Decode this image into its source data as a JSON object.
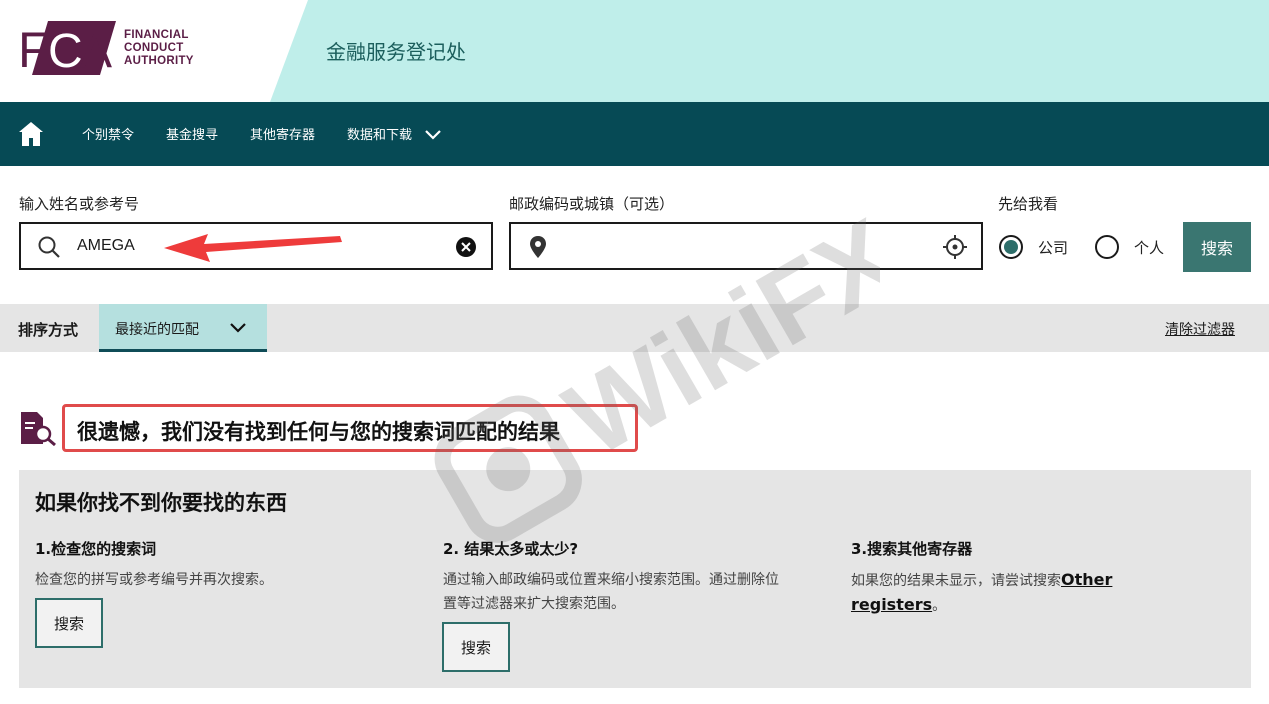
{
  "brand": {
    "logo_letters": "FCA",
    "logo_words": [
      "FINANCIAL",
      "CONDUCT",
      "AUTHORITY"
    ],
    "site_title": "金融服务登记处",
    "brand_color": "#5b1e46",
    "header_accent": "#bfeeea",
    "nav_color": "#064a55"
  },
  "nav": {
    "home_icon": "home-icon",
    "items": [
      "个别禁令",
      "基金搜寻",
      "其他寄存器",
      "数据和下载"
    ]
  },
  "search": {
    "name_label": "输入姓名或参考号",
    "name_value": "AMEGA",
    "location_label": "邮政编码或城镇（可选）",
    "location_value": "",
    "show_first_label": "先给我看",
    "options": [
      "公司",
      "个人"
    ],
    "selected_option": "公司",
    "button_label": "搜索"
  },
  "sort": {
    "label": "排序方式",
    "value": "最接近的匹配",
    "clear_label": "清除过滤器"
  },
  "no_results": {
    "message": "很遗憾，我们没有找到任何与您的搜索词匹配的结果"
  },
  "help": {
    "title": "如果你找不到你要找的东西",
    "col1": {
      "heading": "1.检查您的搜索词",
      "text": "检查您的拼写或参考编号并再次搜索。",
      "button": "搜索"
    },
    "col2": {
      "heading": "2. 结果太多或太少?",
      "text_line1": "通过输入邮政编码或位置来缩小搜索范围。通过删除位",
      "text_line2": "置等过滤器来扩大搜索范围。",
      "button": "搜索"
    },
    "col3": {
      "heading": "3.搜索其他寄存器",
      "text": "如果您的结果未显示，请尝试搜索",
      "link_line1": "Other",
      "link_line2": "registers",
      "suffix": "。"
    }
  },
  "watermark": "WikiFX"
}
